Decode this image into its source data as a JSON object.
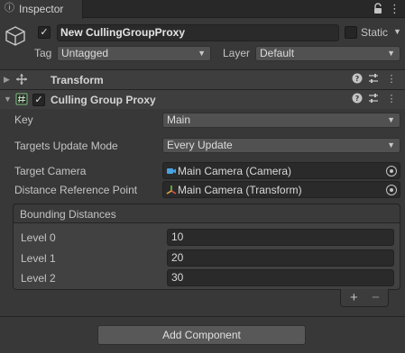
{
  "tab": {
    "label": "Inspector",
    "icon": "info-icon"
  },
  "header": {
    "enabled": true,
    "name": "New CullingGroupProxy",
    "static_label": "Static",
    "tag_label": "Tag",
    "tag_value": "Untagged",
    "layer_label": "Layer",
    "layer_value": "Default"
  },
  "components": [
    {
      "title": "Transform",
      "expanded": false
    },
    {
      "title": "Culling Group Proxy",
      "expanded": true,
      "enabled": true
    }
  ],
  "culling": {
    "key_label": "Key",
    "key_value": "Main",
    "targets_update_label": "Targets Update Mode",
    "targets_update_value": "Every Update",
    "target_camera_label": "Target Camera",
    "target_camera_value": "Main Camera (Camera)",
    "distance_ref_label": "Distance Reference Point",
    "distance_ref_value": "Main Camera (Transform)",
    "bounding_title": "Bounding Distances",
    "levels": [
      {
        "label": "Level 0",
        "value": "10"
      },
      {
        "label": "Level 1",
        "value": "20"
      },
      {
        "label": "Level 2",
        "value": "30"
      }
    ],
    "add_symbol": "+",
    "remove_symbol": "−"
  },
  "add_component_label": "Add Component",
  "colors": {
    "background": "#383838",
    "field": "#2a2a2a",
    "accent_camera": "#4aa3e0"
  }
}
